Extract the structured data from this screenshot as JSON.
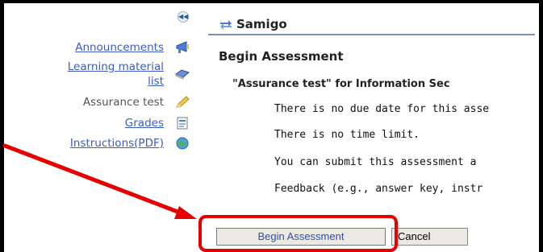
{
  "sidebar": {
    "collapse_glyph": "◀◀",
    "items": [
      {
        "label": "Announcements",
        "icon": "megaphone-icon",
        "link": true
      },
      {
        "label": "Learning material",
        "label2": "list",
        "icon": "book-icon",
        "link": true
      },
      {
        "label": "Assurance test",
        "icon": "pencil-icon",
        "link": false
      },
      {
        "label": "Grades",
        "icon": "gradebook-icon",
        "link": true
      },
      {
        "label": "Instructions(PDF)",
        "icon": "globe-icon",
        "link": true
      }
    ]
  },
  "tool": {
    "title": "Samigo"
  },
  "assessment": {
    "heading": "Begin Assessment",
    "subheading": "\"Assurance test\" for Information Sec",
    "lines": [
      "There is no due date for this asse",
      "There is no time limit.",
      "You can submit this assessment a",
      "Feedback (e.g., answer key, instr"
    ]
  },
  "buttons": {
    "begin_label": "Begin Assessment",
    "cancel_label": "Cancel"
  },
  "colors": {
    "link": "#3a5cc4",
    "highlight": "#e60000",
    "divider": "#7a93b3"
  }
}
